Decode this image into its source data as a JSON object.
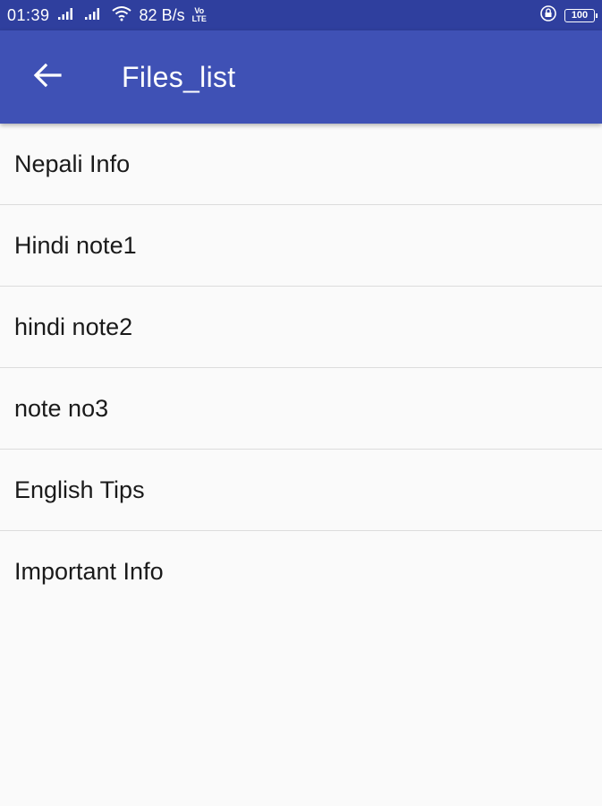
{
  "status_bar": {
    "time": "01:39",
    "network_speed": "82 B/s",
    "volte_top": "Vo",
    "volte_bottom": "LTE",
    "battery": "100"
  },
  "app_bar": {
    "title": "Files_list",
    "back_icon": "arrow-left-icon"
  },
  "files": [
    {
      "label": "Nepali Info"
    },
    {
      "label": "Hindi note1"
    },
    {
      "label": "hindi note2"
    },
    {
      "label": "note no3"
    },
    {
      "label": "English Tips"
    },
    {
      "label": "Important Info"
    }
  ],
  "colors": {
    "app_bar": "#3f51b5",
    "status_bar": "#2f3f9e",
    "background": "#fafafa"
  }
}
